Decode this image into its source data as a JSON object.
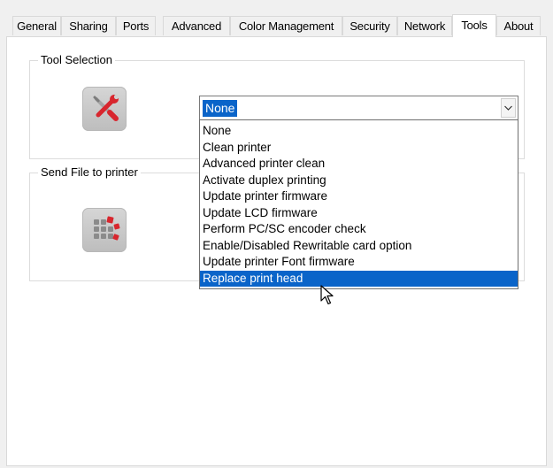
{
  "tabs": [
    {
      "label": "General",
      "active": false
    },
    {
      "label": "Sharing",
      "active": false
    },
    {
      "label": "Ports",
      "active": false
    },
    {
      "label": "Advanced",
      "active": false
    },
    {
      "label": "Color Management",
      "active": false
    },
    {
      "label": "Security",
      "active": false
    },
    {
      "label": "Network",
      "active": false
    },
    {
      "label": "Tools",
      "active": true
    },
    {
      "label": "About",
      "active": false
    }
  ],
  "tool_selection": {
    "group_label": "Tool Selection",
    "icon": "wrench-screwdriver-icon",
    "combo_value": "None",
    "options": [
      "None",
      "Clean printer",
      "Advanced printer clean",
      "Activate duplex printing",
      "Update printer firmware",
      "Update LCD firmware",
      "Perform PC/SC encoder check",
      "Enable/Disabled Rewritable card option",
      "Update printer Font firmware",
      "Replace print head"
    ],
    "highlighted_option": "Replace print head"
  },
  "send_file": {
    "group_label": "Send File to printer",
    "icon": "send-file-grid-icon"
  },
  "colors": {
    "selection": "#0a64c9",
    "accent_red": "#d8262e"
  }
}
